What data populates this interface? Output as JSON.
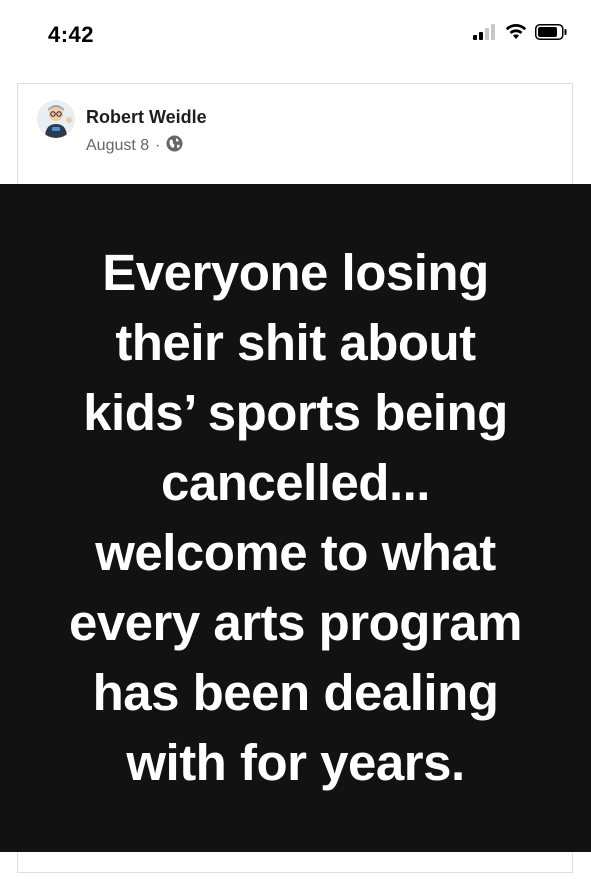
{
  "status_bar": {
    "time": "4:42",
    "icons": [
      "signal-icon",
      "wifi-icon",
      "battery-icon"
    ]
  },
  "post": {
    "author": "Robert Weidle",
    "date": "August 8",
    "separator": "·",
    "audience_icon": "globe-icon",
    "image_text": "Everyone losing\ntheir shit about\nkids’ sports being\ncancelled...\nwelcome to what\nevery arts program\nhas been dealing\nwith for years."
  },
  "colors": {
    "image_background": "#121212",
    "image_text": "#ffffff",
    "meta_text": "#65676b",
    "card_border": "#dddfe2"
  }
}
